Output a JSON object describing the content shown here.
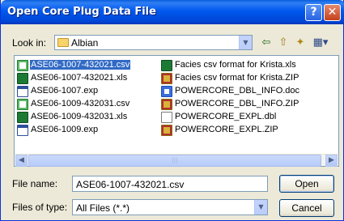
{
  "window": {
    "title": "Open Core Plug Data File",
    "help_glyph": "?",
    "close_glyph": "✕"
  },
  "look_in": {
    "label": "Look in:",
    "value": "Albian",
    "arrow": "▼"
  },
  "toolbar": {
    "back_glyph": "⇦",
    "up_glyph": "⇧",
    "new_folder_glyph": "✦",
    "views_glyph": "▦▾"
  },
  "files": {
    "column1": [
      {
        "name": "ASE06-1007-432021.csv",
        "icon": "csv-icon",
        "selected": true
      },
      {
        "name": "ASE06-1007-432021.xls",
        "icon": "xls-icon"
      },
      {
        "name": "ASE06-1007.exp",
        "icon": "exp-icon"
      },
      {
        "name": "ASE06-1009-432031.csv",
        "icon": "csv-icon"
      },
      {
        "name": "ASE06-1009-432031.xls",
        "icon": "xls-icon"
      },
      {
        "name": "ASE06-1009.exp",
        "icon": "exp-icon"
      }
    ],
    "column2": [
      {
        "name": "Facies csv format for Krista.xls",
        "icon": "xls-icon"
      },
      {
        "name": "Facies csv format for Krista.ZIP",
        "icon": "zip-icon"
      },
      {
        "name": "POWERCORE_DBL_INFO.doc",
        "icon": "doc-icon"
      },
      {
        "name": "POWERCORE_DBL_INFO.ZIP",
        "icon": "zip-icon"
      },
      {
        "name": "POWERCORE_EXPL.dbl",
        "icon": "dbl-icon"
      },
      {
        "name": "POWERCORE_EXPL.ZIP",
        "icon": "zip-icon"
      }
    ]
  },
  "scrollbar": {
    "left_glyph": "◀",
    "right_glyph": "▶",
    "grip": "|||"
  },
  "file_name": {
    "label": "File name:",
    "value": "ASE06-1007-432021.csv"
  },
  "file_type": {
    "label": "Files of type:",
    "value": "All Files (*.*)",
    "arrow": "▼"
  },
  "buttons": {
    "open": "Open",
    "cancel": "Cancel"
  }
}
